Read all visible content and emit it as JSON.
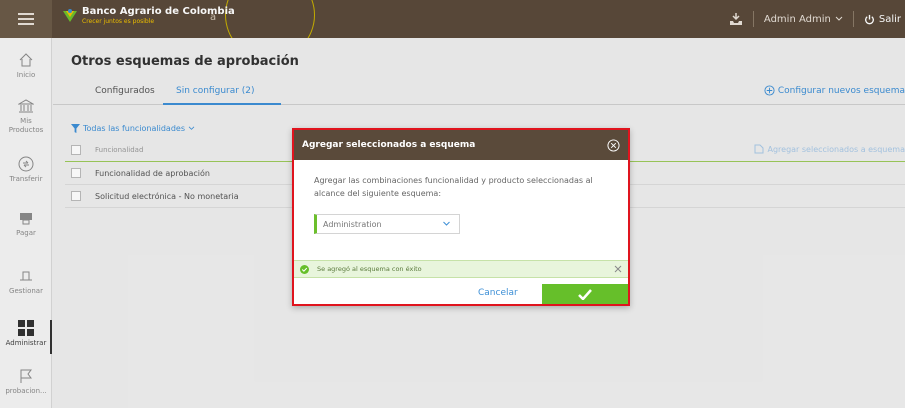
{
  "header": {
    "brand_name": "Banco Agrario de Colombia",
    "brand_tagline": "Crecer juntos es posible",
    "brand_suffix": "a",
    "user_name": "Admin Admin",
    "logout_label": "Salir"
  },
  "sidebar": {
    "items": [
      {
        "label": "Inicio",
        "icon": "home-icon"
      },
      {
        "label": "Mis Productos",
        "icon": "bank-icon"
      },
      {
        "label": "Transferir",
        "icon": "transfer-icon"
      },
      {
        "label": "Pagar",
        "icon": "pay-icon"
      },
      {
        "label": "Gestionar",
        "icon": "manage-icon"
      },
      {
        "label": "Administrar",
        "icon": "admin-grid-icon"
      },
      {
        "label": "probacion...",
        "icon": "flag-icon"
      }
    ]
  },
  "main": {
    "title": "Otros esquemas de aprobación",
    "tabs": [
      {
        "label": "Configurados"
      },
      {
        "label": "Sin configurar (2)"
      }
    ],
    "config_link": "Configurar nuevos esquema",
    "filter_label": "Todas las funcionalidades",
    "add_selected_link": "Agregar seleccionados a esquema",
    "table": {
      "header": "Funcionalidad",
      "rows": [
        "Funcionalidad de aprobación",
        "Solicitud electrónica - No monetaria"
      ]
    }
  },
  "modal": {
    "title": "Agregar seleccionados a esquema",
    "description": "Agregar las combinaciones funcionalidad y producto seleccionadas al alcance del siguiente esquema:",
    "select_value": "Administration",
    "toast": "Se agregó al esquema con éxito",
    "cancel_label": "Cancelar"
  },
  "colors": {
    "header_brown": "#5a4a3a",
    "accent_blue": "#3d8fd6",
    "success_green": "#66bf2a",
    "highlight_red": "#e0141e"
  }
}
